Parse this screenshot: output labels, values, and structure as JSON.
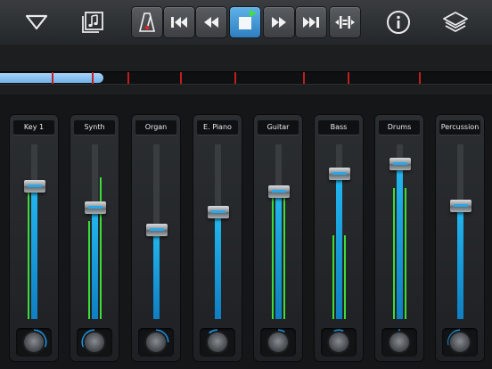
{
  "toolbar": {
    "left_icons": [
      "menu-triangle-icon",
      "song-library-icon"
    ],
    "transport": [
      "metronome-icon",
      "rewind-to-start-icon",
      "rewind-icon",
      "stop-icon",
      "fast-forward-icon",
      "skip-to-end-icon",
      "loop-icon"
    ],
    "right_icons": [
      "info-icon",
      "layers-icon"
    ],
    "accent": "#3a8fd6"
  },
  "timeline": {
    "progress": 0.21
  },
  "mixer": {
    "channels": [
      {
        "name": "Key 1",
        "level": 0.76,
        "meter_left": 0.76,
        "meter_right": 0.0
      },
      {
        "name": "Synth",
        "level": 0.64,
        "meter_left": 0.56,
        "meter_right": 0.81
      },
      {
        "name": "Organ",
        "level": 0.51,
        "meter_left": 0.0,
        "meter_right": 0.0
      },
      {
        "name": "E. Piano",
        "level": 0.61,
        "meter_left": 0.0,
        "meter_right": 0.0
      },
      {
        "name": "Guitar",
        "level": 0.73,
        "meter_left": 0.71,
        "meter_right": 0.71
      },
      {
        "name": "Bass",
        "level": 0.83,
        "meter_left": 0.48,
        "meter_right": 0.48
      },
      {
        "name": "Drums",
        "level": 0.89,
        "meter_left": 0.75,
        "meter_right": 0.75
      },
      {
        "name": "Percussion",
        "level": 0.65,
        "meter_left": 0.0,
        "meter_right": 0.0
      }
    ]
  }
}
